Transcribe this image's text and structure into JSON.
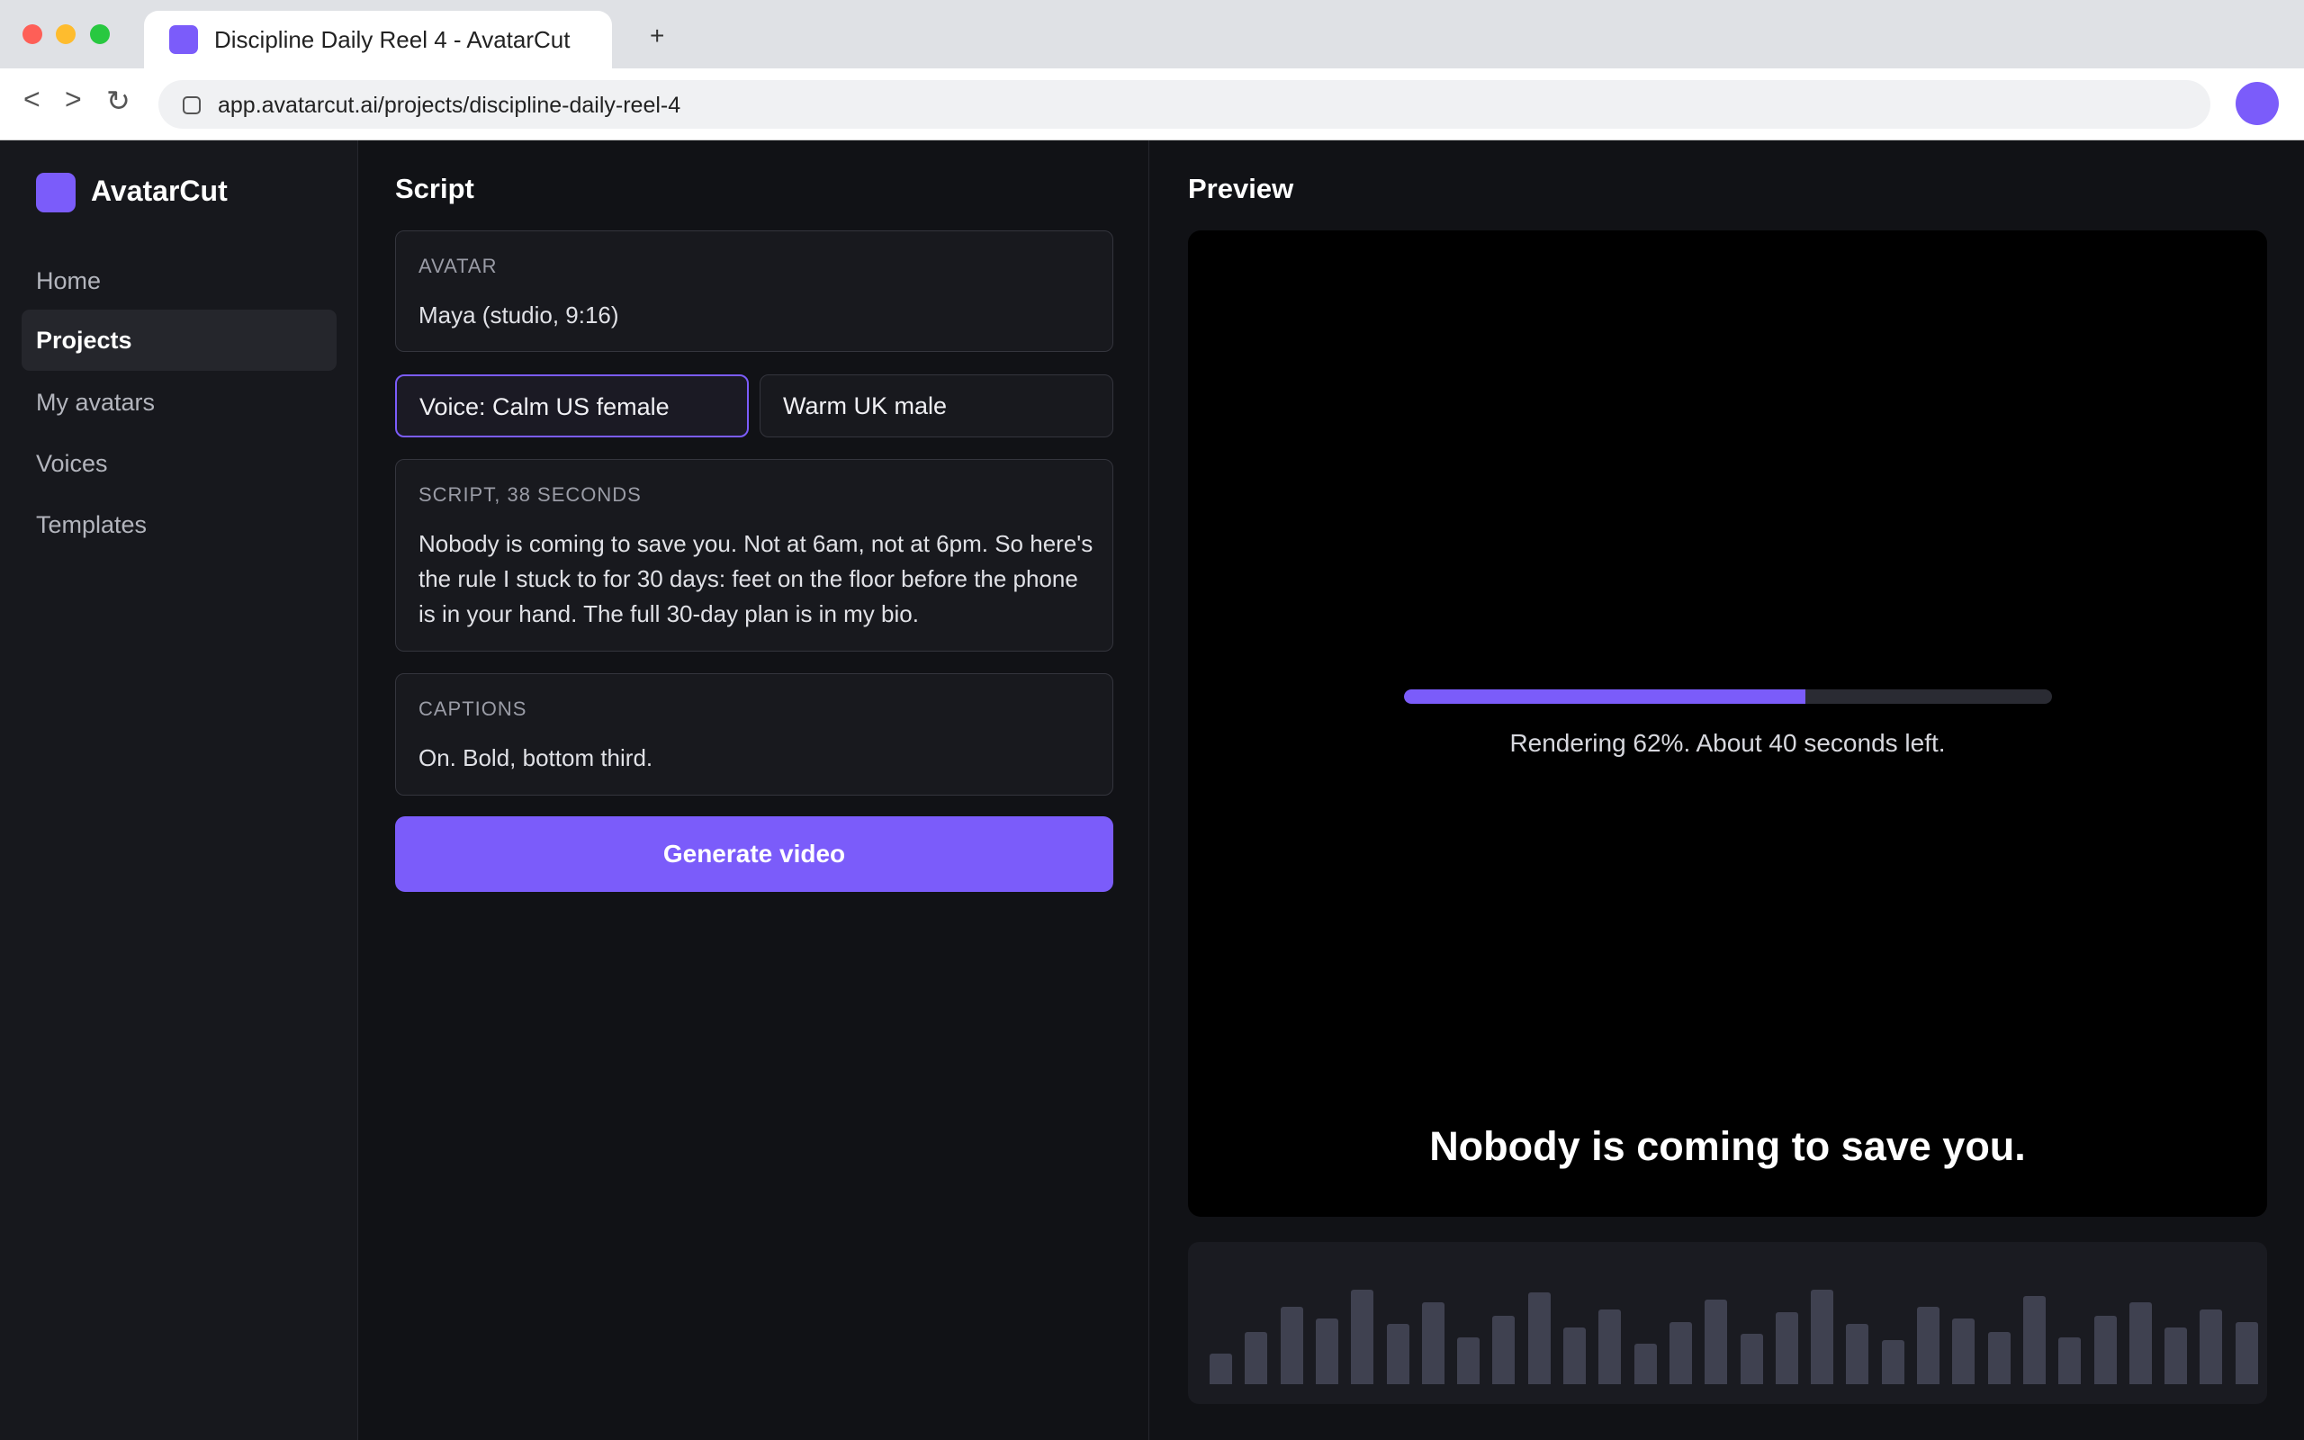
{
  "browser": {
    "tab_title": "Discipline Daily Reel 4 - AvatarCut",
    "new_tab_label": "+",
    "back_label": "<",
    "forward_label": ">",
    "reload_label": "↻",
    "url": "app.avatarcut.ai/projects/discipline-daily-reel-4"
  },
  "sidebar": {
    "brand": "AvatarCut",
    "items": [
      {
        "label": "Home",
        "active": false
      },
      {
        "label": "Projects",
        "active": true
      },
      {
        "label": "My avatars",
        "active": false
      },
      {
        "label": "Voices",
        "active": false
      },
      {
        "label": "Templates",
        "active": false
      }
    ]
  },
  "script_panel": {
    "title": "Script",
    "avatar": {
      "label": "AVATAR",
      "value": "Maya (studio, 9:16)"
    },
    "voices": [
      {
        "label": "Voice: Calm US female",
        "selected": true
      },
      {
        "label": "Warm UK male",
        "selected": false
      }
    ],
    "script": {
      "label": "SCRIPT, 38 SECONDS",
      "text": "Nobody is coming to save you. Not at 6am, not at 6pm. So here's the rule I stuck to for 30 days: feet on the floor before the phone is in your hand. The full 30-day plan is in my bio."
    },
    "captions": {
      "label": "CAPTIONS",
      "value": "On. Bold, bottom third."
    },
    "generate_label": "Generate video"
  },
  "preview": {
    "title": "Preview",
    "progress_percent": 62,
    "render_status": "Rendering 62%. About 40 seconds left.",
    "caption_text": "Nobody is coming to save you.",
    "waveform_levels": [
      0.25,
      0.43,
      0.63,
      0.54,
      0.77,
      0.49,
      0.67,
      0.38,
      0.56,
      0.75,
      0.46,
      0.61,
      0.33,
      0.51,
      0.69,
      0.41,
      0.59,
      0.77,
      0.49,
      0.36,
      0.63,
      0.54,
      0.43,
      0.72,
      0.38,
      0.56,
      0.67,
      0.46,
      0.61,
      0.51
    ]
  },
  "colors": {
    "accent": "#7b5cfa",
    "background": "#111216",
    "sidebar": "#17181d",
    "card": "#18191e",
    "waveform_bar": "#3f4150"
  }
}
